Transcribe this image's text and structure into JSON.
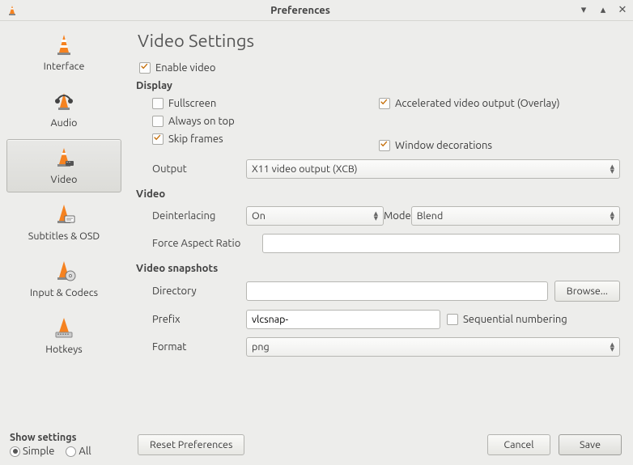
{
  "window": {
    "title": "Preferences"
  },
  "sidebar": {
    "items": [
      {
        "label": "Interface"
      },
      {
        "label": "Audio"
      },
      {
        "label": "Video"
      },
      {
        "label": "Subtitles & OSD"
      },
      {
        "label": "Input & Codecs"
      },
      {
        "label": "Hotkeys"
      }
    ]
  },
  "page_title": "Video Settings",
  "enable_video": "Enable video",
  "sections": {
    "display": {
      "title": "Display",
      "fullscreen": "Fullscreen",
      "always_on_top": "Always on top",
      "skip_frames": "Skip frames",
      "accel": "Accelerated video output (Overlay)",
      "win_dec": "Window decorations",
      "output_label": "Output",
      "output_value": "X11 video output (XCB)"
    },
    "video": {
      "title": "Video",
      "deint_label": "Deinterlacing",
      "deint_value": "On",
      "mode_label": "Mode",
      "mode_value": "Blend",
      "force_ar_label": "Force Aspect Ratio",
      "force_ar_value": ""
    },
    "snapshots": {
      "title": "Video snapshots",
      "dir_label": "Directory",
      "dir_value": "",
      "browse": "Browse...",
      "prefix_label": "Prefix",
      "prefix_value": "vlcsnap-",
      "seq_label": "Sequential numbering",
      "format_label": "Format",
      "format_value": "png"
    }
  },
  "show_settings": {
    "title": "Show settings",
    "simple": "Simple",
    "all": "All"
  },
  "buttons": {
    "reset": "Reset Preferences",
    "cancel": "Cancel",
    "save": "Save"
  }
}
